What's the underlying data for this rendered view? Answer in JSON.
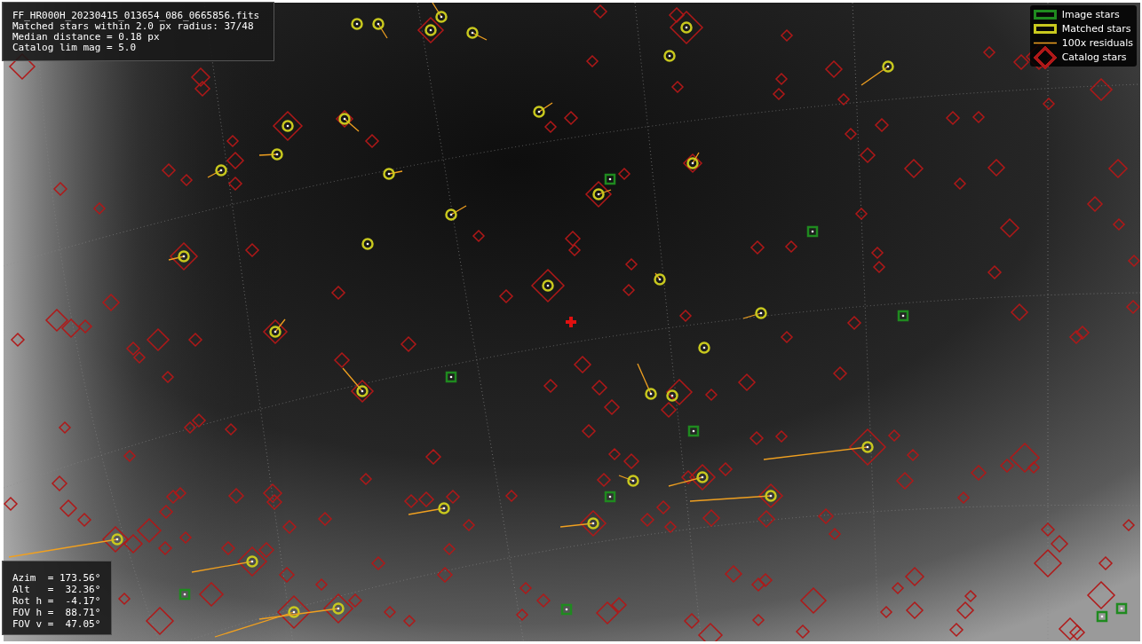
{
  "info_box": {
    "lines": [
      "FF_HR000H_20230415_013654_086_0665856.fits",
      "Matched stars within 2.0 px radius: 37/48",
      "Median distance = 0.18 px",
      "Catalog lim mag = 5.0"
    ]
  },
  "legend": [
    {
      "kind": "box",
      "label": "Image stars",
      "color": "#1f8a1f"
    },
    {
      "kind": "box",
      "label": "Matched stars",
      "color": "#c8c81e"
    },
    {
      "kind": "line",
      "label": "100x residuals",
      "color": "#f0a020"
    },
    {
      "kind": "diamond",
      "label": "Catalog stars",
      "color": "#b01818"
    }
  ],
  "pointing_box": {
    "lines": [
      "Azim  = 173.56°",
      "Alt   =  32.36°",
      "Rot h =  -4.17°",
      "FOV h =  88.71°",
      "FOV v =  47.05°"
    ]
  }
}
